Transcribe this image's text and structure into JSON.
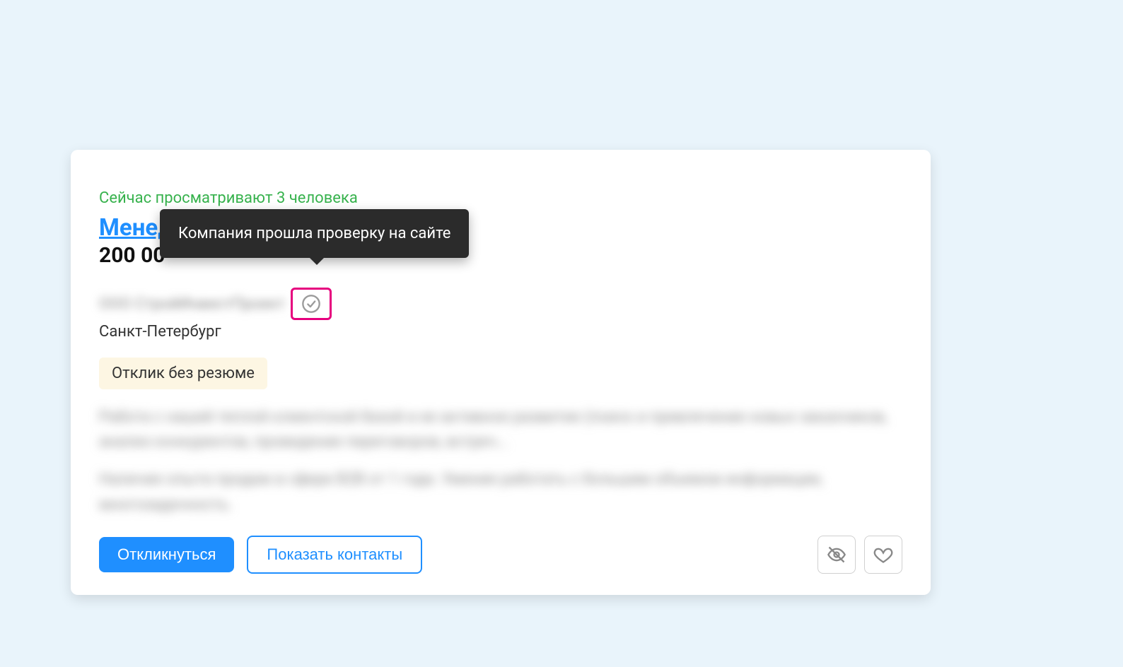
{
  "card": {
    "viewing_now": "Сейчас просматривают 3 человека",
    "title_visible": "Менед",
    "salary_visible": "200 00",
    "company_blurred": "ООО СтройИнвестПроект",
    "city": "Санкт-Петербург",
    "badge": "Отклик без резюме",
    "desc1_blurred": "Работа с нашей теплой клиентской базой и ее активное развитие (поиск и привлечение новых заказчиков, анализ конкурентов, проведение переговоров, встреч...",
    "desc2_blurred": "Наличие опыта продаж в сфере B2B от 1 года. Умение работать с большим объемом информации, многозадачность."
  },
  "actions": {
    "apply": "Откликнуться",
    "show_contacts": "Показать контакты"
  },
  "tooltip": {
    "text": "Компания прошла проверку на сайте"
  },
  "icons": {
    "verify": "check-circle-icon",
    "hide": "eye-off-icon",
    "favorite": "heart-icon"
  },
  "colors": {
    "accent": "#1f8fff",
    "success": "#37b24d",
    "highlight_border": "#e6007e",
    "tooltip_bg": "#2b2b2b",
    "badge_bg": "#fdf6e3",
    "page_bg": "#e9f4fb"
  }
}
